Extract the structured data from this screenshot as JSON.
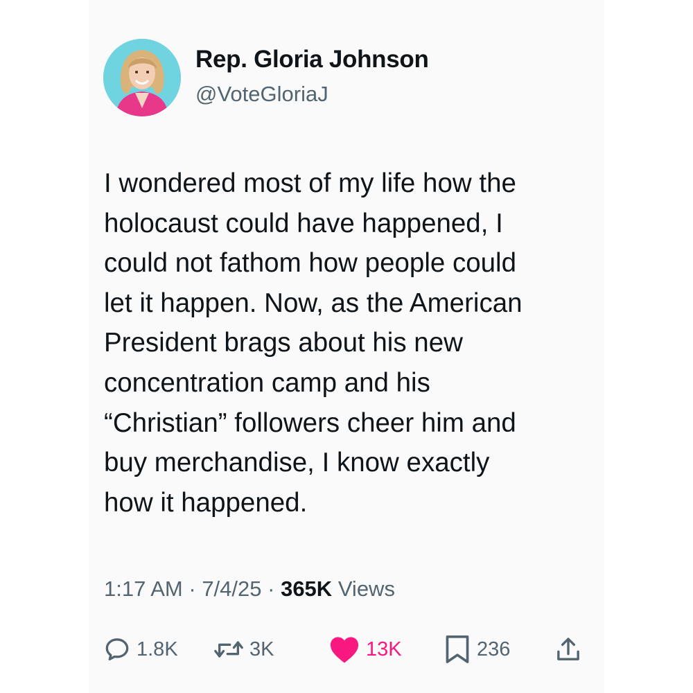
{
  "tweet": {
    "display_name": "Rep. Gloria Johnson",
    "handle": "@VoteGloriaJ",
    "text_lines": [
      "I wondered most of my life how the",
      "holocaust could have happened, I",
      "could not fathom how people could",
      "let it happen. Now, as the American",
      "President brags about his new",
      "concentration camp and his",
      "“Christian” followers cheer him and",
      "buy merchandise, I know exactly",
      "how it happened."
    ],
    "time": "1:17 AM",
    "date": "7/4/25",
    "separator": "·",
    "views_count": "365K",
    "views_label": "Views"
  },
  "actions": {
    "reply": {
      "icon": "reply-icon",
      "count": "1.8K"
    },
    "retweet": {
      "icon": "retweet-icon",
      "count": "3K"
    },
    "like": {
      "icon": "heart-icon",
      "count": "13K",
      "color": "#f91880",
      "liked": true
    },
    "bookmark": {
      "icon": "bookmark-icon",
      "count": "236"
    },
    "share": {
      "icon": "share-icon"
    }
  },
  "colors": {
    "text_primary": "#0f1419",
    "text_secondary": "#536471",
    "like_active": "#f91880",
    "card_background": "#fafafa"
  }
}
